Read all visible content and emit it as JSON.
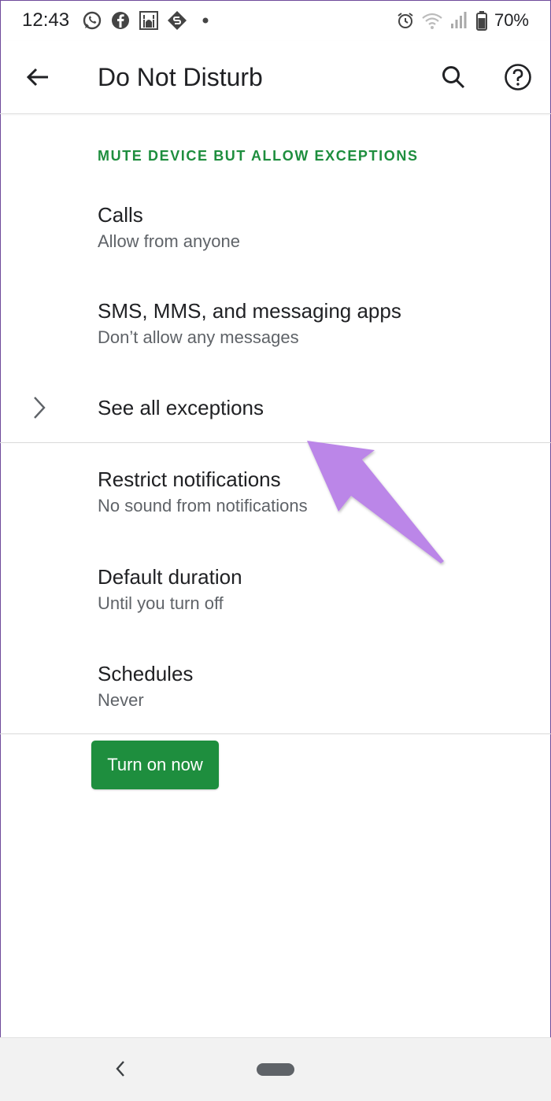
{
  "status_bar": {
    "time": "12:43",
    "battery": "70%",
    "icons": [
      "whatsapp-icon",
      "facebook-icon",
      "mosque-icon",
      "s-app-icon",
      "dot-icon",
      "alarm-icon",
      "wifi-icon",
      "signal-icon",
      "battery-icon"
    ]
  },
  "app_bar": {
    "title": "Do Not Disturb"
  },
  "section": {
    "header": "MUTE DEVICE BUT ALLOW EXCEPTIONS"
  },
  "preferences": [
    {
      "title": "Calls",
      "summary": "Allow from anyone"
    },
    {
      "title": "SMS, MMS, and messaging apps",
      "summary": "Don’t allow any messages"
    },
    {
      "title": "See all exceptions"
    },
    {
      "title": "Restrict notifications",
      "summary": "No sound from notifications"
    },
    {
      "title": "Default duration",
      "summary": "Until you turn off"
    },
    {
      "title": "Schedules",
      "summary": "Never"
    }
  ],
  "turn_on_button": {
    "label": "Turn on now"
  },
  "colors": {
    "accent": "#1e8e3e",
    "annotation_arrow": "#bb86e8"
  }
}
